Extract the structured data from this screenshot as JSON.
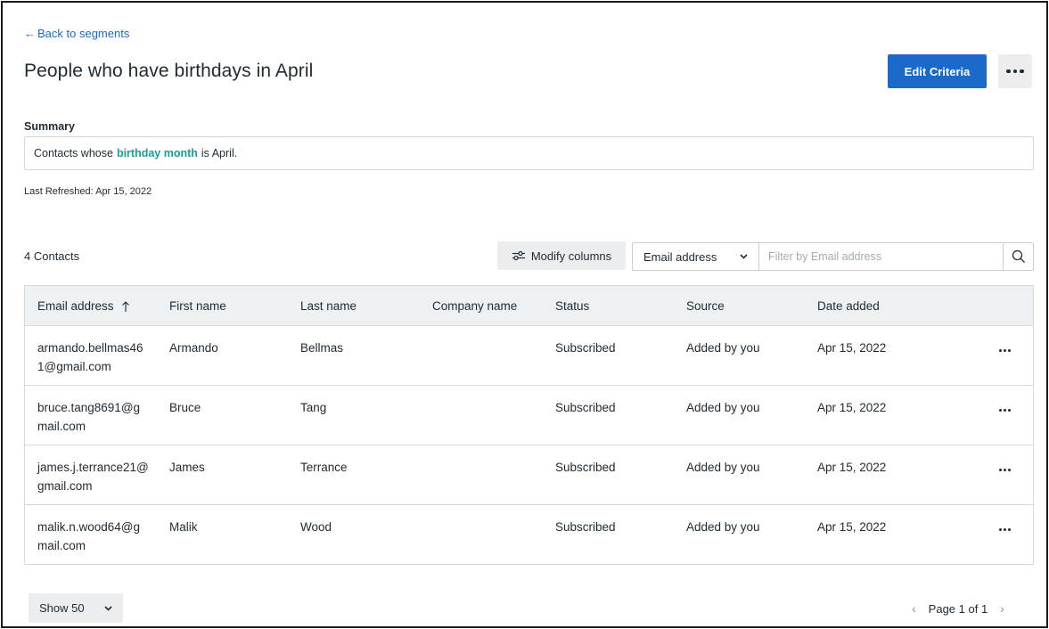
{
  "nav": {
    "back_label": "Back to segments"
  },
  "header": {
    "title": "People who have birthdays in April",
    "edit_label": "Edit Criteria"
  },
  "summary": {
    "label": "Summary",
    "prefix": "Contacts whose",
    "highlight": "birthday month",
    "suffix": "is April."
  },
  "last_refreshed": "Last Refreshed: Apr 15, 2022",
  "toolbar": {
    "count": "4 Contacts",
    "modify_label": "Modify columns",
    "filter_field": "Email address",
    "filter_placeholder": "Filter by Email address"
  },
  "table": {
    "columns": [
      "Email address",
      "First name",
      "Last name",
      "Company name",
      "Status",
      "Source",
      "Date added"
    ],
    "rows": [
      {
        "email": "armando.bellmas461@gmail.com",
        "first": "Armando",
        "last": "Bellmas",
        "company": "",
        "status": "Subscribed",
        "source": "Added by you",
        "date": "Apr 15, 2022"
      },
      {
        "email": "bruce.tang8691@gmail.com",
        "first": "Bruce",
        "last": "Tang",
        "company": "",
        "status": "Subscribed",
        "source": "Added by you",
        "date": "Apr 15, 2022"
      },
      {
        "email": "james.j.terrance21@gmail.com",
        "first": "James",
        "last": "Terrance",
        "company": "",
        "status": "Subscribed",
        "source": "Added by you",
        "date": "Apr 15, 2022"
      },
      {
        "email": "malik.n.wood64@gmail.com",
        "first": "Malik",
        "last": "Wood",
        "company": "",
        "status": "Subscribed",
        "source": "Added by you",
        "date": "Apr 15, 2022"
      }
    ]
  },
  "footer": {
    "show_label": "Show 50",
    "page_label": "Page 1 of 1"
  },
  "colors": {
    "primary": "#1b6ac9",
    "highlight": "#1b9c96",
    "header_bg": "#eef1f4"
  }
}
